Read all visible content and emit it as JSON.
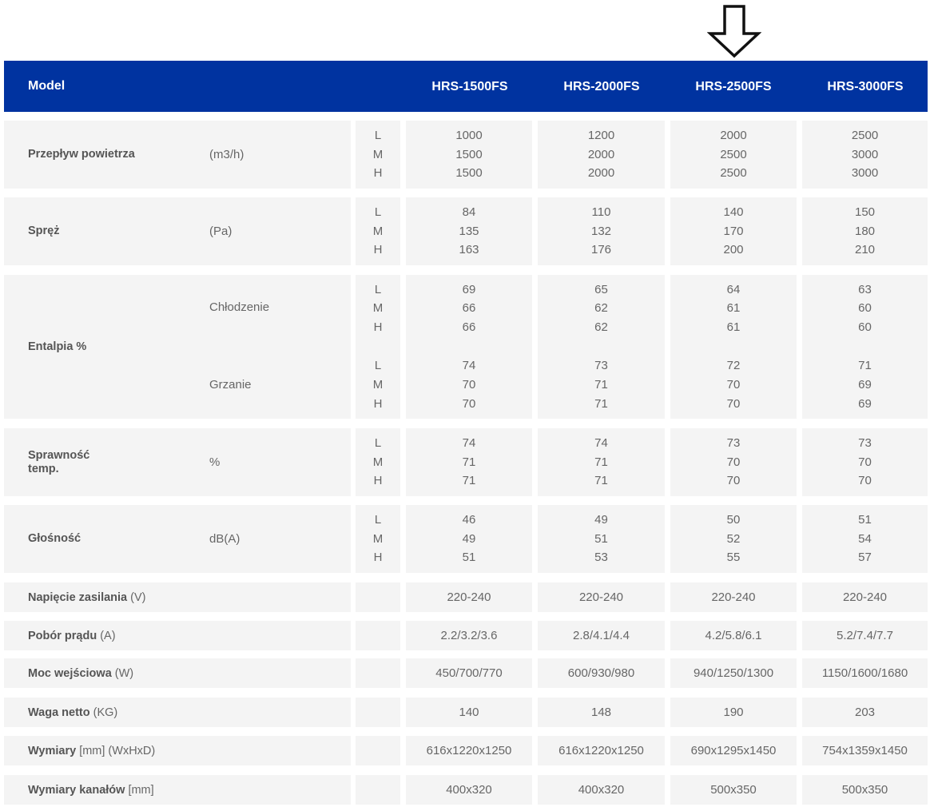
{
  "header": {
    "model_label": "Model",
    "models": [
      "HRS-1500FS",
      "HRS-2000FS",
      "HRS-2500FS",
      "HRS-3000FS"
    ]
  },
  "annotation": {
    "arrow_icon": "arrow-down-outline-icon",
    "points_to": "HRS-2500FS"
  },
  "lmh": [
    "L",
    "M",
    "H"
  ],
  "groups": [
    {
      "name": "Przepływ powietrza",
      "unit": "(m3/h)",
      "values": [
        [
          "1000",
          "1500",
          "1500"
        ],
        [
          "1200",
          "2000",
          "2000"
        ],
        [
          "2000",
          "2500",
          "2500"
        ],
        [
          "2500",
          "3000",
          "3000"
        ]
      ]
    },
    {
      "name": "Spręż",
      "unit": "(Pa)",
      "values": [
        [
          "84",
          "135",
          "163"
        ],
        [
          "110",
          "132",
          "176"
        ],
        [
          "140",
          "170",
          "200"
        ],
        [
          "150",
          "180",
          "210"
        ]
      ]
    },
    {
      "name": "Entalpia %",
      "sub_cooling": "Chłodzenie",
      "sub_heating": "Grzanie",
      "values_cooling": [
        [
          "69",
          "66",
          "66"
        ],
        [
          "65",
          "62",
          "62"
        ],
        [
          "64",
          "61",
          "61"
        ],
        [
          "63",
          "60",
          "60"
        ]
      ],
      "values_heating": [
        [
          "74",
          "70",
          "70"
        ],
        [
          "73",
          "71",
          "71"
        ],
        [
          "72",
          "70",
          "70"
        ],
        [
          "71",
          "69",
          "69"
        ]
      ]
    },
    {
      "name": "Sprawność temp.",
      "unit": "%",
      "values": [
        [
          "74",
          "71",
          "71"
        ],
        [
          "74",
          "71",
          "71"
        ],
        [
          "73",
          "70",
          "70"
        ],
        [
          "73",
          "70",
          "70"
        ]
      ]
    },
    {
      "name": "Głośność",
      "unit": "dB(A)",
      "values": [
        [
          "46",
          "49",
          "51"
        ],
        [
          "49",
          "51",
          "53"
        ],
        [
          "50",
          "52",
          "55"
        ],
        [
          "51",
          "54",
          "57"
        ]
      ]
    }
  ],
  "singles": [
    {
      "name": "Napięcie zasilania",
      "unit": "(V)",
      "values": [
        "220-240",
        "220-240",
        "220-240",
        "220-240"
      ]
    },
    {
      "name": "Pobór prądu",
      "unit": "(A)",
      "values": [
        "2.2/3.2/3.6",
        "2.8/4.1/4.4",
        "4.2/5.8/6.1",
        "5.2/7.4/7.7"
      ]
    },
    {
      "name": "Moc wejściowa",
      "unit": "(W)",
      "values": [
        "450/700/770",
        "600/930/980",
        "940/1250/1300",
        "1150/1600/1680"
      ]
    },
    {
      "name": "Waga netto",
      "unit": "(KG)",
      "values": [
        "140",
        "148",
        "190",
        "203"
      ]
    },
    {
      "name": "Wymiary",
      "unit": "[mm] (WxHxD)",
      "values": [
        "616x1220x1250",
        "616x1220x1250",
        "690x1295x1450",
        "754x1359x1450"
      ]
    },
    {
      "name": "Wymiary kanałów",
      "unit": "[mm]",
      "values": [
        "400x320",
        "400x320",
        "500x350",
        "500x350"
      ]
    }
  ]
}
